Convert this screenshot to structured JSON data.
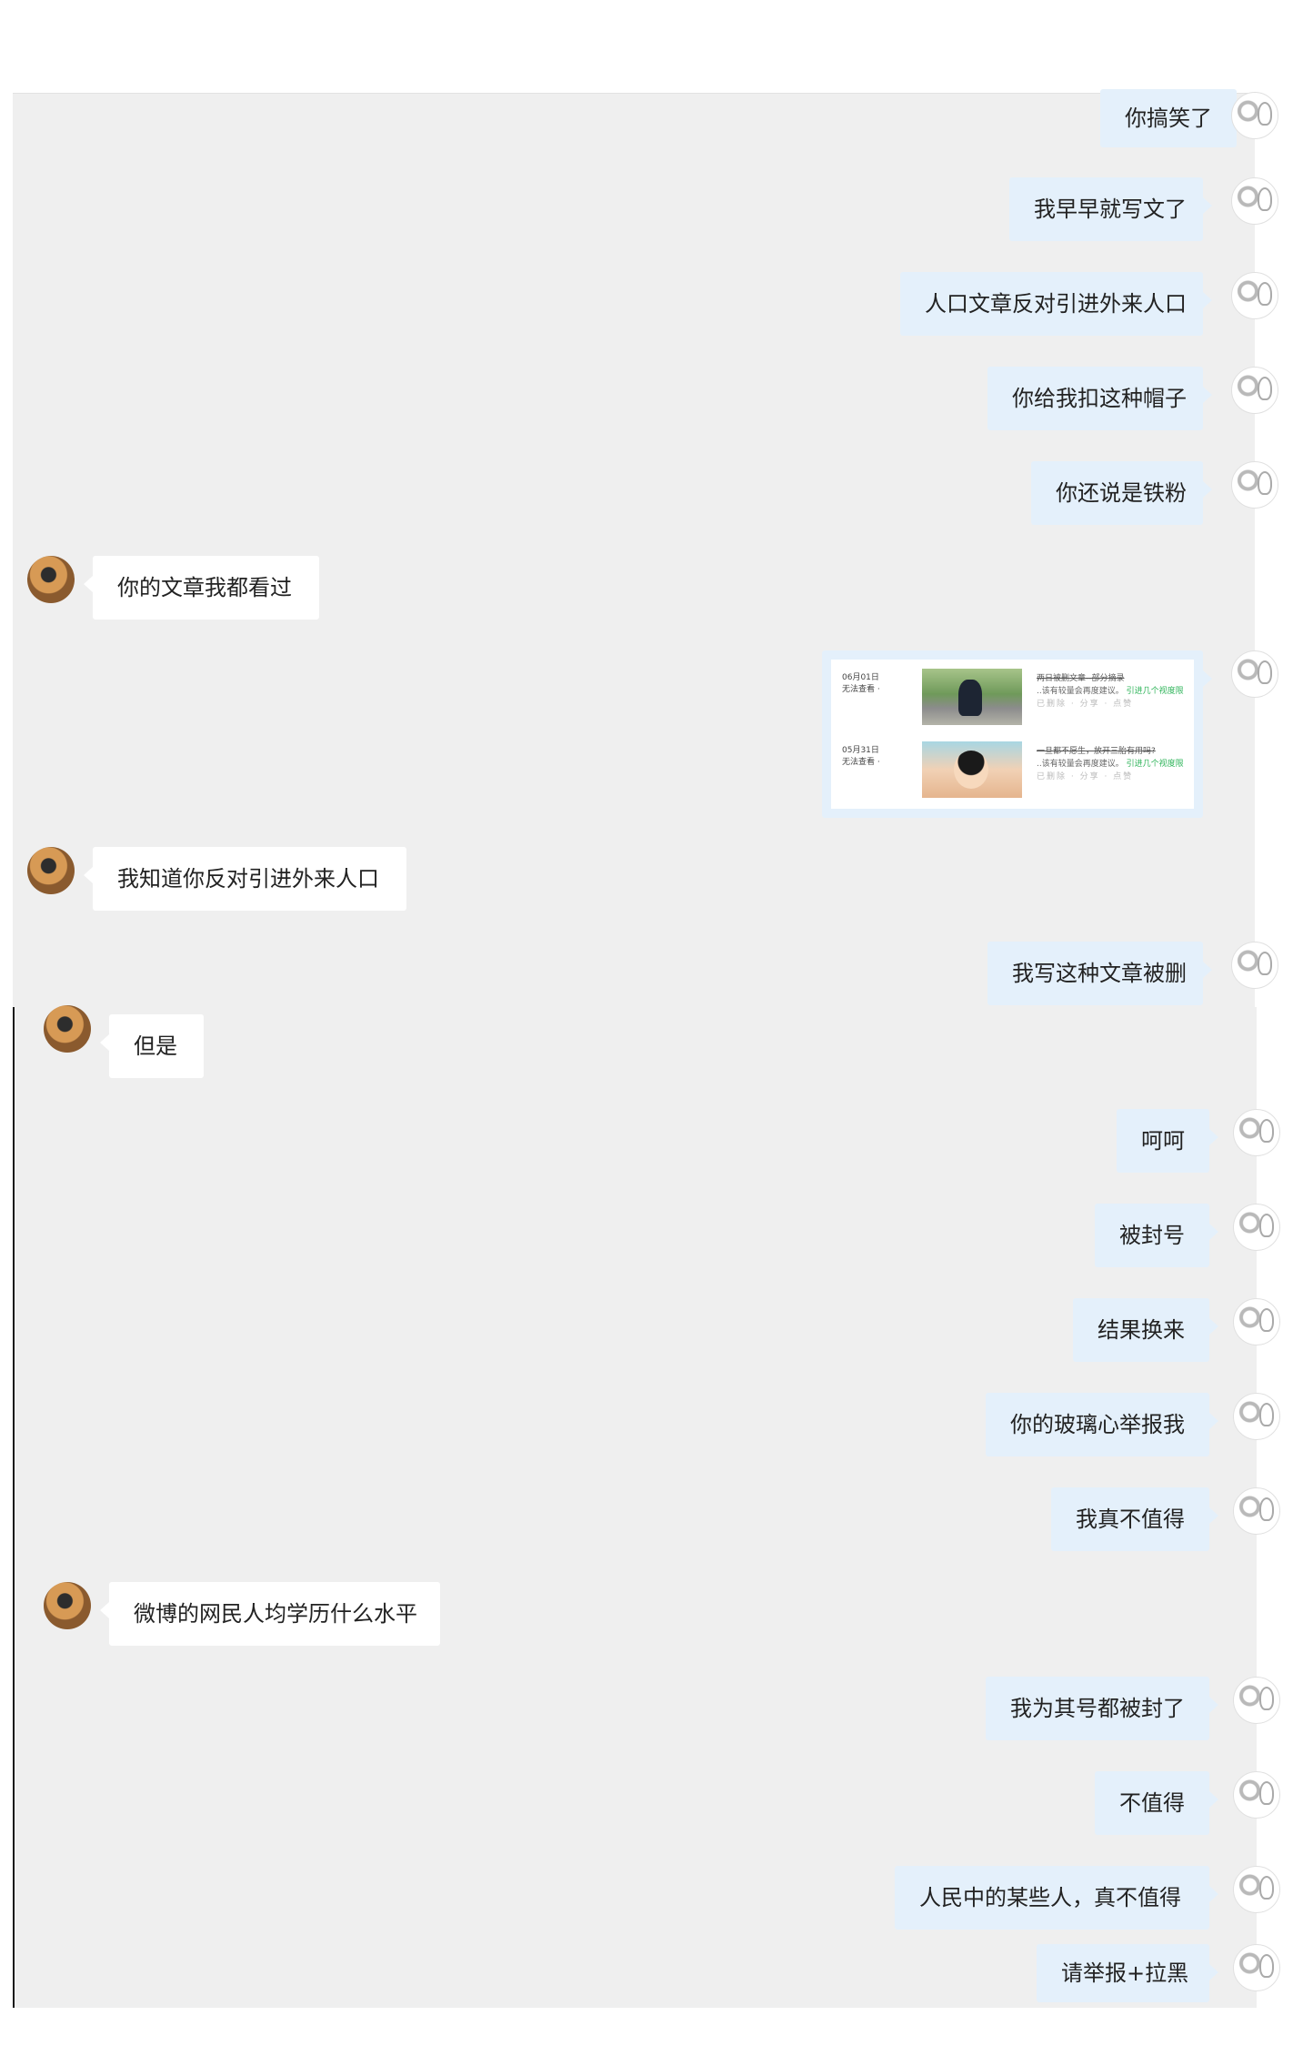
{
  "messages_top": [
    {
      "from": "me",
      "text": "你搞笑了"
    },
    {
      "from": "me",
      "text": "我早早就写文了"
    },
    {
      "from": "me",
      "text": "人口文章反对引进外来人口"
    },
    {
      "from": "me",
      "text": "你给我扣这种帽子"
    },
    {
      "from": "me",
      "text": "你还说是铁粉"
    },
    {
      "from": "them",
      "text": "你的文章我都看过"
    },
    {
      "from": "me",
      "type": "image"
    },
    {
      "from": "them",
      "text": "我知道你反对引进外来人口"
    },
    {
      "from": "me",
      "text": "我写这种文章被删"
    }
  ],
  "shared_image": {
    "rows": [
      {
        "date": "06月01日",
        "status": "无法查看 ·",
        "title": "两日被删文章--部分摘录",
        "summary": "..该有较量会再度建议。",
        "highlight": "引进几个视度限",
        "stats": "已删除 · 分享 · 点赞"
      },
      {
        "date": "05月31日",
        "status": "无法查看 ·",
        "title": "一旦都不愿生，放开三胎有用吗?",
        "summary": "..该有较量会再度建议。",
        "highlight": "引进几个视度限",
        "stats": "已删除 · 分享 · 点赞"
      }
    ]
  },
  "messages_bottom": [
    {
      "from": "them",
      "text": "但是"
    },
    {
      "from": "me",
      "text": "呵呵"
    },
    {
      "from": "me",
      "text": "被封号"
    },
    {
      "from": "me",
      "text": "结果换来"
    },
    {
      "from": "me",
      "text": "你的玻璃心举报我"
    },
    {
      "from": "me",
      "text": "我真不值得"
    },
    {
      "from": "them",
      "text": "微博的网民人均学历什么水平"
    },
    {
      "from": "me",
      "text": "我为其号都被封了"
    },
    {
      "from": "me",
      "text": "不值得"
    },
    {
      "from": "me",
      "text": "人民中的某些人，真不值得"
    },
    {
      "from": "me",
      "text": "请举报+拉黑"
    }
  ]
}
